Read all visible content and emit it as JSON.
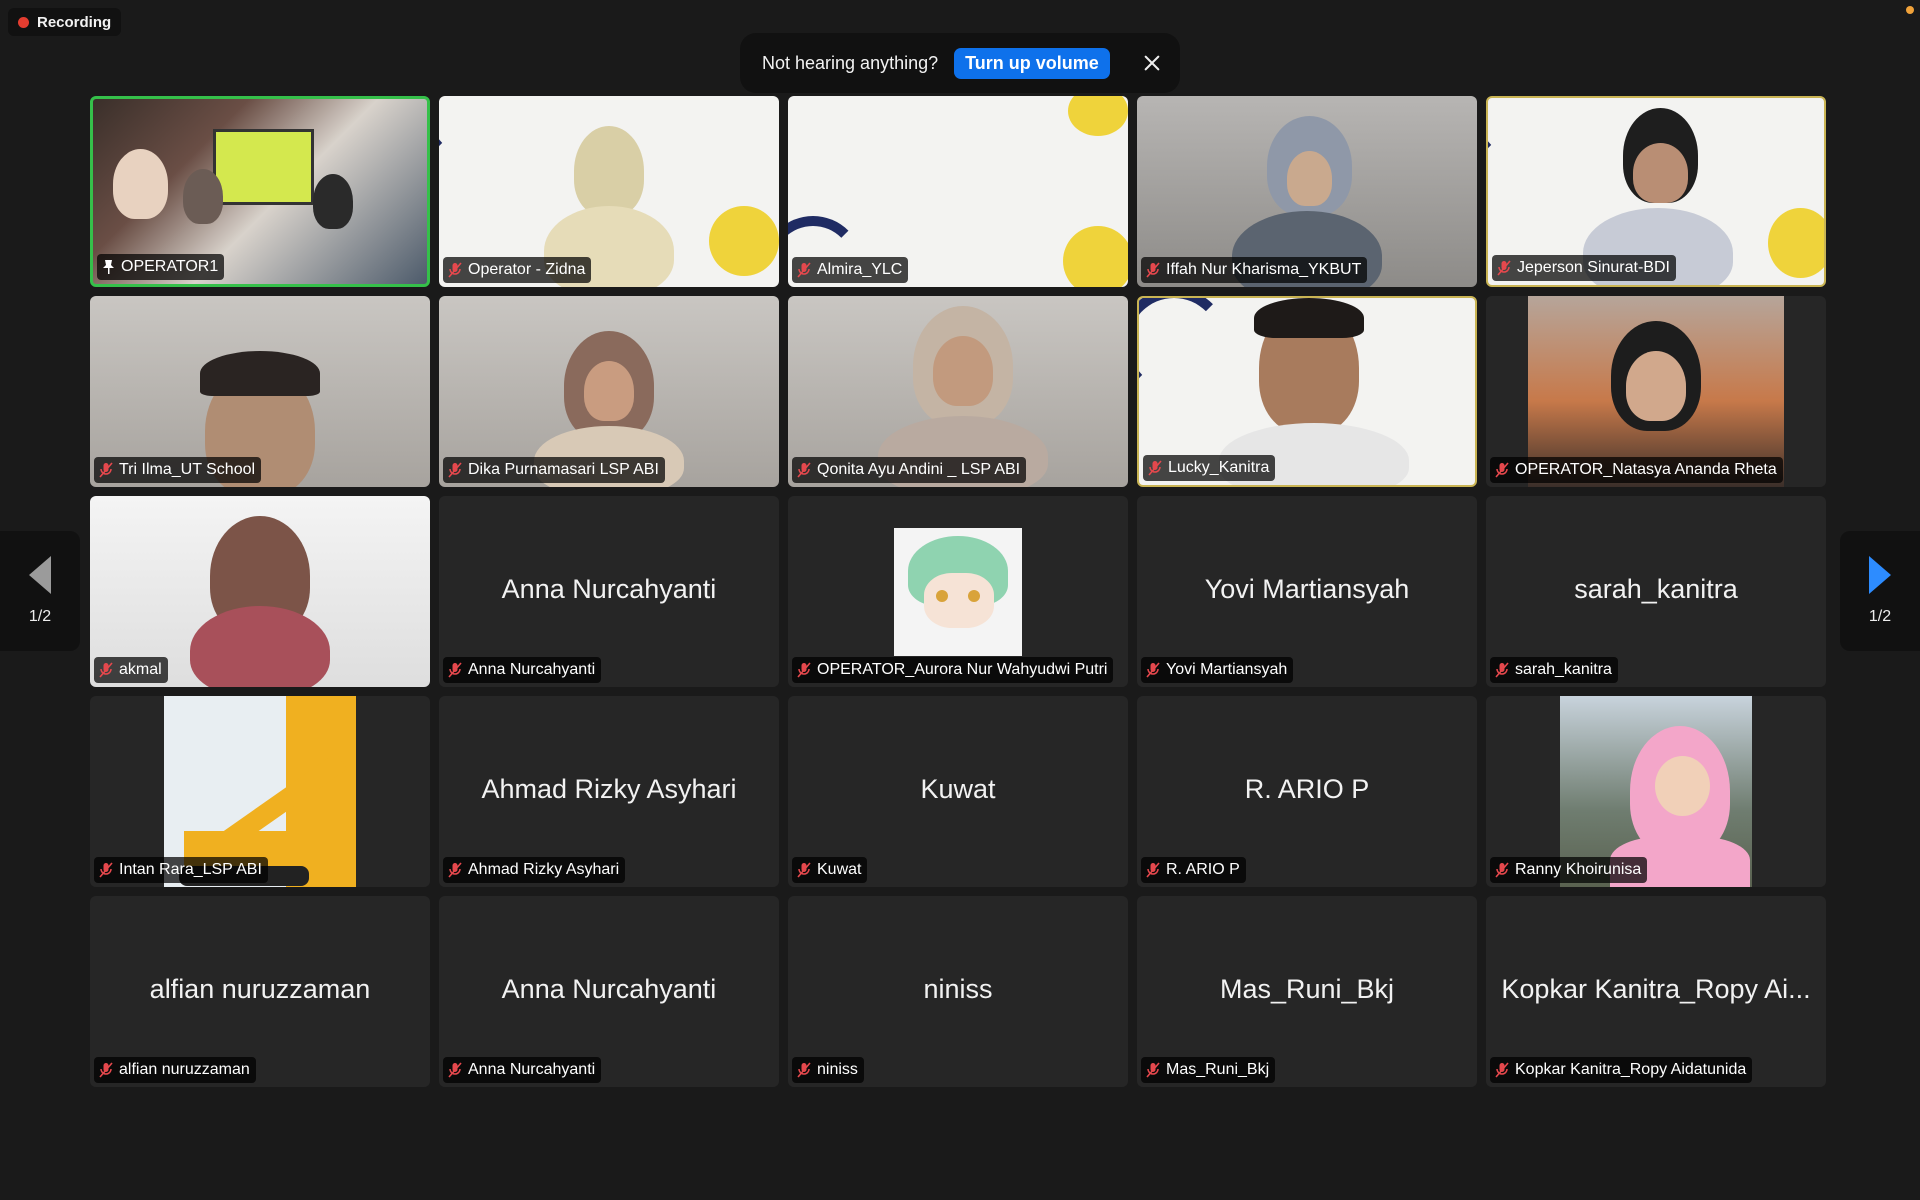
{
  "recording": {
    "label": "Recording"
  },
  "notice": {
    "text": "Not hearing anything?",
    "button": "Turn up volume"
  },
  "pager": {
    "left_label": "1/2",
    "right_label": "1/2"
  },
  "tiles": [
    {
      "name": "OPERATOR1",
      "big": "",
      "pinned": true
    },
    {
      "name": "Operator - Zidna",
      "big": ""
    },
    {
      "name": "Almira_YLC",
      "big": ""
    },
    {
      "name": "Iffah Nur Kharisma_YKBUT",
      "big": ""
    },
    {
      "name": "Jeperson Sinurat-BDI",
      "big": ""
    },
    {
      "name": "Tri Ilma_UT School",
      "big": ""
    },
    {
      "name": "Dika Purnamasari LSP ABI",
      "big": ""
    },
    {
      "name": "Qonita Ayu Andini _ LSP ABI",
      "big": ""
    },
    {
      "name": "Lucky_Kanitra",
      "big": ""
    },
    {
      "name": "OPERATOR_Natasya Ananda Rheta",
      "big": ""
    },
    {
      "name": "akmal",
      "big": ""
    },
    {
      "name": "Anna Nurcahyanti",
      "big": "Anna Nurcahyanti"
    },
    {
      "name": "OPERATOR_Aurora Nur Wahyudwi Putri",
      "big": ""
    },
    {
      "name": "Yovi Martiansyah",
      "big": "Yovi Martiansyah"
    },
    {
      "name": "sarah_kanitra",
      "big": "sarah_kanitra"
    },
    {
      "name": "Intan Rara_LSP ABI",
      "big": ""
    },
    {
      "name": "Ahmad Rizky Asyhari",
      "big": "Ahmad Rizky Asyhari"
    },
    {
      "name": "Kuwat",
      "big": "Kuwat"
    },
    {
      "name": "R. ARIO P",
      "big": "R. ARIO P"
    },
    {
      "name": "Ranny Khoirunisa",
      "big": ""
    },
    {
      "name": "alfian nuruzzaman",
      "big": "alfian nuruzzaman"
    },
    {
      "name": "Anna Nurcahyanti",
      "big": "Anna Nurcahyanti"
    },
    {
      "name": "niniss",
      "big": "niniss"
    },
    {
      "name": "Mas_Runi_Bkj",
      "big": "Mas_Runi_Bkj"
    },
    {
      "name": "Kopkar Kanitra_Ropy Aidatunida",
      "big": "Kopkar Kanitra_Ropy Ai..."
    }
  ],
  "colors": {
    "accent": "#0e71eb",
    "active_border": "#35c04a",
    "muted": "#e5484d"
  }
}
